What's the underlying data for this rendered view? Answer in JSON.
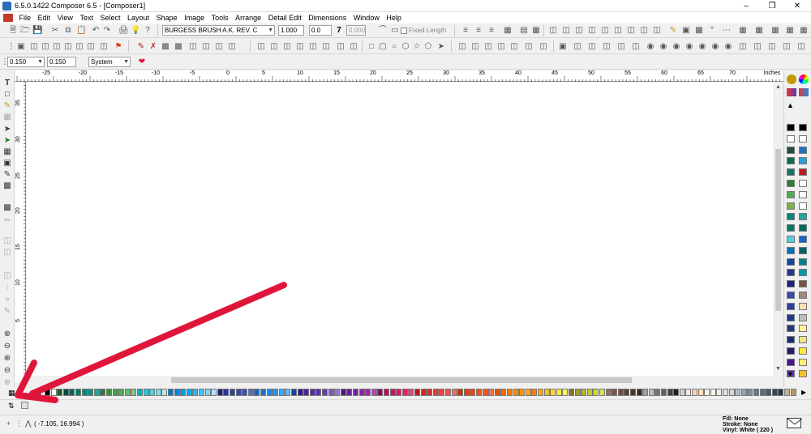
{
  "window": {
    "title": "6.5.0.1422 Composer 6.5 - [Composer1]",
    "minimize_icon": "minimize-icon",
    "restore_icon": "restore-icon",
    "close_icon": "close-icon"
  },
  "menu": {
    "items": [
      "File",
      "Edit",
      "View",
      "Text",
      "Select",
      "Layout",
      "Shape",
      "Image",
      "Tools",
      "Arrange",
      "Detail Edit",
      "Dimensions",
      "Window",
      "Help"
    ]
  },
  "toolbar1": {
    "font_name": "BURGESS BRUSH A.K. REV. C",
    "font_size": "1.000",
    "slant_value": "0.0",
    "slant_symbol": "7",
    "disabled_value": "0.000",
    "fixed_length_label": "Fixed Length"
  },
  "toolbar3": {
    "width_value": "0.150",
    "height_value": "0.150",
    "units_select": "System"
  },
  "ruler": {
    "unit_label": "Inches",
    "h_labels": [
      "-25",
      "-20",
      "-15",
      "-10",
      "-5",
      "0",
      "5",
      "10",
      "15",
      "20",
      "25",
      "30",
      "35",
      "40",
      "45",
      "50",
      "55",
      "60",
      "65",
      "70"
    ],
    "v_labels": [
      "35",
      "30",
      "25",
      "20",
      "15",
      "10",
      "5"
    ]
  },
  "status": {
    "coordinates": "( -7.105, 16.994 )",
    "fill": "Fill: None",
    "stroke": "Stroke: None",
    "vinyl": "Vinyl: White ( 220 )"
  },
  "colors": {
    "accent_arrow": "#e0153a",
    "titlebar_bg": "#ffffff",
    "app_bg": "#f0f0f0",
    "right_palette": [
      "#000000",
      "#000000",
      "#ffffff",
      "#ffffff",
      "#1f4e3d",
      "#1e73be",
      "#0b6e4f",
      "#2aa0d8",
      "#117a65",
      "#b71c1c",
      "#2e7d32",
      "#ffffff",
      "#4caf50",
      "#ffffff",
      "#7cb342",
      "#ffffff",
      "#00897b",
      "#26a69a",
      "#00796b",
      "#00695c",
      "#4dd0e1",
      "#1565c0",
      "#0277bd",
      "#006064",
      "#0d47a1",
      "#00838f",
      "#283593",
      "#0097a7",
      "#1a237e",
      "#795548",
      "#3949ab",
      "#a1887f",
      "#303f9f",
      "#ffe0b2",
      "#1e3a8a",
      "#bdbdbd",
      "#283a78",
      "#fff59d",
      "#1a2f6b",
      "#f0e68c",
      "#2e1a6b",
      "#ffeb3b",
      "#4a148c",
      "#fff176",
      "#5e35b1",
      "#fbc02d"
    ],
    "bottom_palette": [
      "#000000",
      "#ffffff",
      "#1b5e20",
      "#004d40",
      "#00695c",
      "#00796b",
      "#00897b",
      "#009688",
      "#26a69a",
      "#2e7d32",
      "#388e3c",
      "#43a047",
      "#4caf50",
      "#66bb6a",
      "#81c784",
      "#00acc1",
      "#26c6da",
      "#4dd0e1",
      "#80deea",
      "#b2ebf2",
      "#0277bd",
      "#0288d1",
      "#039be5",
      "#03a9f4",
      "#29b6f6",
      "#4fc3f7",
      "#81d4fa",
      "#b3e5fc",
      "#1a237e",
      "#283593",
      "#303f9f",
      "#3949ab",
      "#3f51b5",
      "#5c6bc0",
      "#1565c0",
      "#1976d2",
      "#1e88e5",
      "#2196f3",
      "#42a5f5",
      "#64b5f6",
      "#0d47a1",
      "#311b92",
      "#4527a0",
      "#512da8",
      "#5e35b1",
      "#673ab7",
      "#7e57c2",
      "#9575cd",
      "#4a148c",
      "#6a1b9a",
      "#7b1fa2",
      "#8e24aa",
      "#9c27b0",
      "#ab47bc",
      "#880e4f",
      "#ad1457",
      "#c2185b",
      "#d81b60",
      "#e91e63",
      "#ec407a",
      "#b71c1c",
      "#c62828",
      "#d32f2f",
      "#e53935",
      "#f44336",
      "#ef5350",
      "#e57373",
      "#bf360c",
      "#d84315",
      "#e64a19",
      "#f4511e",
      "#ff5722",
      "#ff7043",
      "#e65100",
      "#ef6c00",
      "#f57c00",
      "#fb8c00",
      "#ff9800",
      "#ffa726",
      "#f57f17",
      "#f9a825",
      "#fbc02d",
      "#fdd835",
      "#ffeb3b",
      "#fff176",
      "#827717",
      "#9e9d24",
      "#afb42b",
      "#c0ca33",
      "#cddc39",
      "#d4e157",
      "#8d6e63",
      "#795548",
      "#6d4c41",
      "#5d4037",
      "#4e342e",
      "#3e2723",
      "#9e9e9e",
      "#bdbdbd",
      "#757575",
      "#616161",
      "#424242",
      "#212121",
      "#d7ccc8",
      "#efebe9",
      "#ffccbc",
      "#ffe0b2",
      "#fff8e1",
      "#f5f5f5",
      "#eeeeee",
      "#e0e0e0",
      "#cfd8dc",
      "#b0bec5",
      "#90a4ae",
      "#78909c",
      "#607d8b",
      "#546e7a",
      "#455a64",
      "#37474f",
      "#263238",
      "#c8b08a",
      "#b89868",
      "#a88a5c",
      "#987c50",
      "#886e44",
      "#786038",
      "#68522c",
      "#584420",
      "#483614",
      "#383008",
      "#282004"
    ]
  }
}
